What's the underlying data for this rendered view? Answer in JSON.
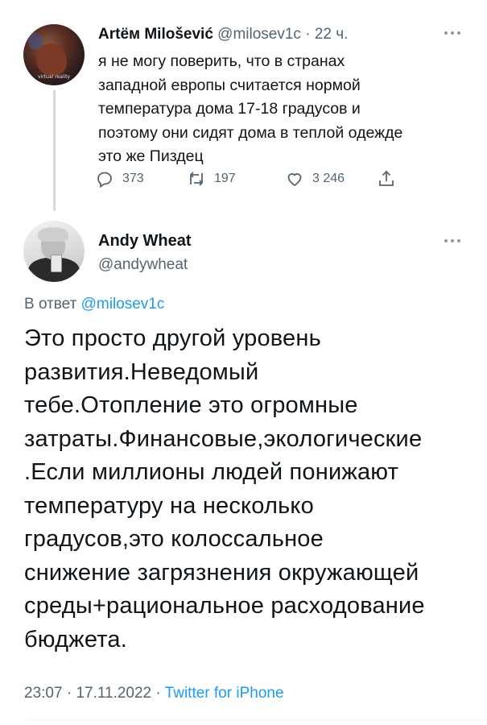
{
  "parent_tweet": {
    "author_name": "Artём Milošević",
    "handle": "@milosev1c",
    "time": "22 ч.",
    "separator": "·",
    "avatar_caption": "virtual reality",
    "text_lines": [
      "я не могу поверить, что в странах",
      "западной европы считается нормой",
      "температура дома 17-18 градусов и",
      "поэтому они сидят дома в теплой одежде",
      "это же Пиздец"
    ],
    "actions": {
      "replies": "373",
      "retweets": "197",
      "likes": "3 246"
    }
  },
  "reply_tweet": {
    "author_name": "Andy Wheat",
    "handle": "@andywheat",
    "reply_prefix": "В ответ",
    "reply_mention": "@milosev1c",
    "text_lines": [
      "Это просто другой уровень",
      "развития.Неведомый",
      "тебе.Отопление это огромные",
      "затраты.Финансовые,экологические",
      ".Если миллионы людей понижают",
      "температуру на несколько",
      "градусов,это колоссальное",
      "снижение загрязнения окружающей",
      "среды+рациональное расходование",
      "бюджета."
    ],
    "time": "23:07",
    "date": "17.11.2022",
    "separator": "·",
    "source": "Twitter for iPhone"
  },
  "colors": {
    "text": "#0f1419",
    "secondary": "#536471",
    "accent": "#1d9bf0",
    "line": "#cfd9de"
  },
  "icons": [
    "reply-icon",
    "retweet-icon",
    "like-icon",
    "share-icon",
    "more-icon"
  ]
}
